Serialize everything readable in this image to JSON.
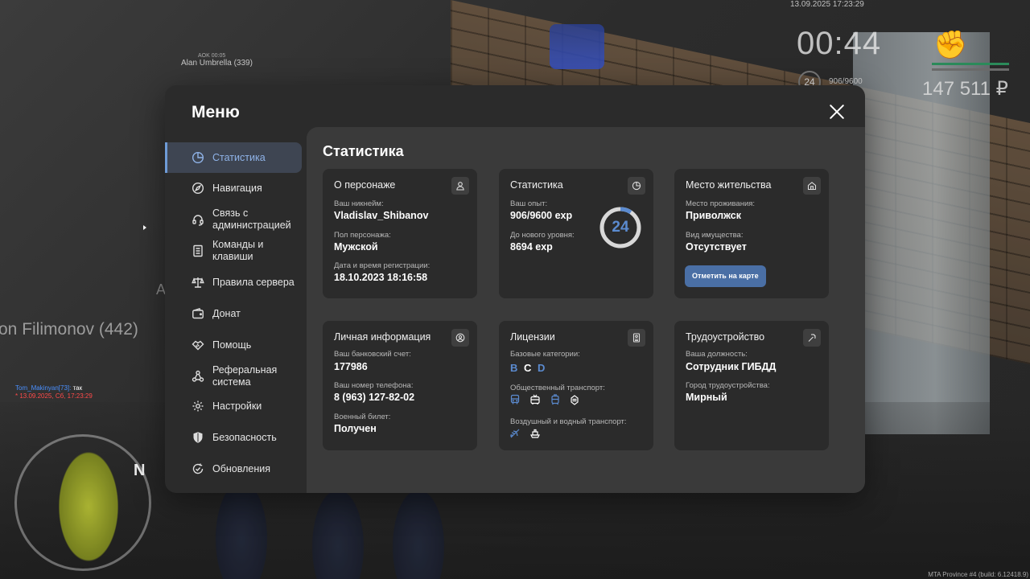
{
  "hud": {
    "nick_small": "AOK 00:05",
    "nick": "Alan Umbrella (339)",
    "player": "on Filimonov (442)",
    "a_letter": "A",
    "chat_name": "Tom_Makinyan[73]:",
    "chat_text": " так",
    "chat_date": "* 13.09.2025, Сб, 17:23:29",
    "date": "13.09.2025 17:23:29",
    "time": "00:44",
    "level": "24",
    "exp": "906/9600",
    "money": "147 511 ₽",
    "compass": "N",
    "footer": "MTA Province #4 (build: 6.12418.9)"
  },
  "menu": {
    "title": "Меню",
    "sidebar": [
      {
        "label": "Статистика",
        "icon": "pie-chart-icon",
        "active": true
      },
      {
        "label": "Навигация",
        "icon": "compass-icon"
      },
      {
        "label": "Связь с администрацией",
        "icon": "headset-icon"
      },
      {
        "label": "Команды и клавиши",
        "icon": "document-icon"
      },
      {
        "label": "Правила сервера",
        "icon": "scales-icon"
      },
      {
        "label": "Донат",
        "icon": "wallet-icon"
      },
      {
        "label": "Помощь",
        "icon": "handshake-icon"
      },
      {
        "label": "Реферальная система",
        "icon": "network-icon"
      },
      {
        "label": "Настройки",
        "icon": "gear-icon"
      },
      {
        "label": "Безопасность",
        "icon": "shield-icon"
      },
      {
        "label": "Обновления",
        "icon": "refresh-check-icon"
      }
    ]
  },
  "content": {
    "title": "Статистика",
    "character": {
      "title": "О персонаже",
      "nickname_label": "Ваш никнейм:",
      "nickname": "Vladislav_Shibanov",
      "gender_label": "Пол персонажа:",
      "gender": "Мужской",
      "reg_label": "Дата и время регистрации:",
      "reg": "18.10.2023 18:16:58"
    },
    "stats": {
      "title": "Статистика",
      "exp_label": "Ваш опыт:",
      "exp": "906/9600 exp",
      "next_label": "До нового уровня:",
      "next": "8694 exp",
      "level": "24",
      "progress": 0.094
    },
    "residence": {
      "title": "Место жительства",
      "place_label": "Место проживания:",
      "place": "Приволжск",
      "property_label": "Вид имущества:",
      "property": "Отсутствует",
      "map_button": "Отметить на карте"
    },
    "personal": {
      "title": "Личная информация",
      "bank_label": "Ваш банковский счет:",
      "bank": "177986",
      "phone_label": "Ваш номер телефона:",
      "phone": "8 (963) 127-82-02",
      "military_label": "Военный билет:",
      "military": "Получен"
    },
    "licenses": {
      "title": "Лицензии",
      "base_label": "Базовые категории:",
      "categories": [
        "B",
        "C",
        "D"
      ],
      "public_label": "Общественный транспорт:",
      "air_label": "Воздушный и водный транспорт:"
    },
    "employment": {
      "title": "Трудоустройство",
      "position_label": "Ваша должность:",
      "position": "Сотрудник ГИБДД",
      "city_label": "Город трудоустройства:",
      "city": "Мирный"
    }
  },
  "colors": {
    "accent": "#5b8bd0",
    "category_active": "#ffffff",
    "category_inactive": "#5b8bd0",
    "button": "#4a6fa5"
  }
}
